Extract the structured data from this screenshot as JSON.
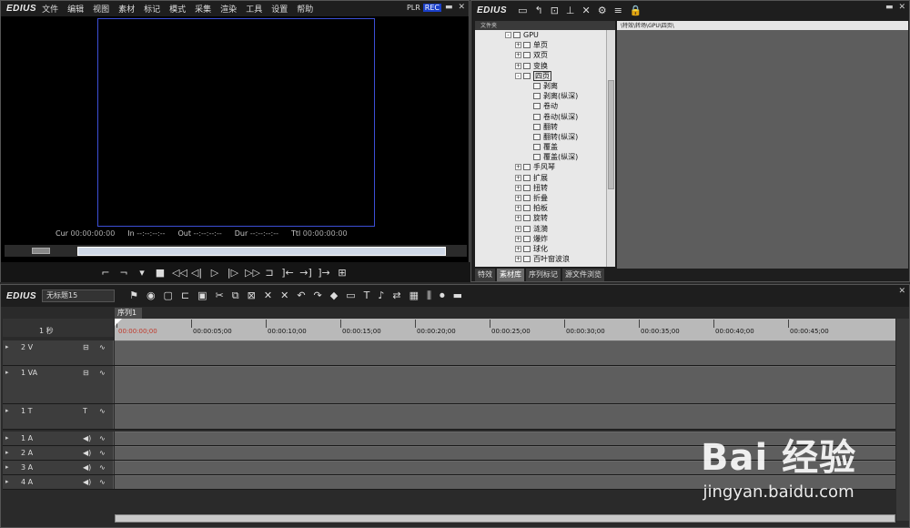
{
  "player": {
    "logo": "EDIUS",
    "menu": [
      "文件",
      "编辑",
      "视图",
      "素材",
      "标记",
      "模式",
      "采集",
      "渲染",
      "工具",
      "设置",
      "帮助"
    ],
    "plr": "PLR",
    "rec": "REC",
    "timecodes": [
      {
        "label": "Cur",
        "value": "00:00:00:00"
      },
      {
        "label": "In",
        "value": "--:--:--:--"
      },
      {
        "label": "Out",
        "value": "--:--:--:--"
      },
      {
        "label": "Dur",
        "value": "--:--:--:--"
      },
      {
        "label": "Ttl",
        "value": "00:00:00:00"
      }
    ]
  },
  "library": {
    "logo": "EDIUS",
    "folder_header": "文件夹",
    "path": "\\特效\\转场\\GPU\\四页\\",
    "tree": [
      {
        "label": "GPU",
        "indent": 3,
        "toggle": "-"
      },
      {
        "label": "单页",
        "indent": 4,
        "toggle": "+"
      },
      {
        "label": "双页",
        "indent": 4,
        "toggle": "+"
      },
      {
        "label": "变换",
        "indent": 4,
        "toggle": "+"
      },
      {
        "label": "四页",
        "indent": 4,
        "toggle": "-",
        "selected": true
      },
      {
        "label": "剥离",
        "indent": 5
      },
      {
        "label": "剥离(纵深)",
        "indent": 5
      },
      {
        "label": "卷动",
        "indent": 5
      },
      {
        "label": "卷动(纵深)",
        "indent": 5
      },
      {
        "label": "翻转",
        "indent": 5
      },
      {
        "label": "翻转(纵深)",
        "indent": 5
      },
      {
        "label": "覆盖",
        "indent": 5
      },
      {
        "label": "覆盖(纵深)",
        "indent": 5
      },
      {
        "label": "手风琴",
        "indent": 4,
        "toggle": "+"
      },
      {
        "label": "扩展",
        "indent": 4,
        "toggle": "+"
      },
      {
        "label": "扭转",
        "indent": 4,
        "toggle": "+"
      },
      {
        "label": "折叠",
        "indent": 4,
        "toggle": "+"
      },
      {
        "label": "拍板",
        "indent": 4,
        "toggle": "+"
      },
      {
        "label": "旋转",
        "indent": 4,
        "toggle": "+"
      },
      {
        "label": "涟漪",
        "indent": 4,
        "toggle": "+"
      },
      {
        "label": "爆炸",
        "indent": 4,
        "toggle": "+"
      },
      {
        "label": "球化",
        "indent": 4,
        "toggle": "+"
      },
      {
        "label": "百叶窗波浪",
        "indent": 4,
        "toggle": "+"
      }
    ],
    "tabs": [
      "特效",
      "素材库",
      "序列标记",
      "源文件浏览"
    ],
    "active_tab": "素材库"
  },
  "timeline": {
    "logo": "EDIUS",
    "project_name": "无标题15",
    "sequence_tab": "序列1",
    "zoom": "1 秒",
    "ruler": [
      "00:00:00;00",
      "00:00:05;00",
      "00:00:10;00",
      "00:00:15;00",
      "00:00:20;00",
      "00:00:25;00",
      "00:00:30;00",
      "00:00:35;00",
      "00:00:40;00",
      "00:00:45;00"
    ],
    "tracks": [
      {
        "name": "2 V",
        "icon": "⊟"
      },
      {
        "name": "1 VA",
        "icon": "⊟"
      },
      {
        "name": "1 T",
        "icon": "T"
      },
      {
        "name": "1 A",
        "icon": "◀)"
      },
      {
        "name": "2 A",
        "icon": "◀)"
      },
      {
        "name": "3 A",
        "icon": "◀)"
      },
      {
        "name": "4 A",
        "icon": "◀)"
      }
    ]
  },
  "watermark": {
    "logo": "Bai 经验",
    "url": "jingyan.baidu.com"
  }
}
